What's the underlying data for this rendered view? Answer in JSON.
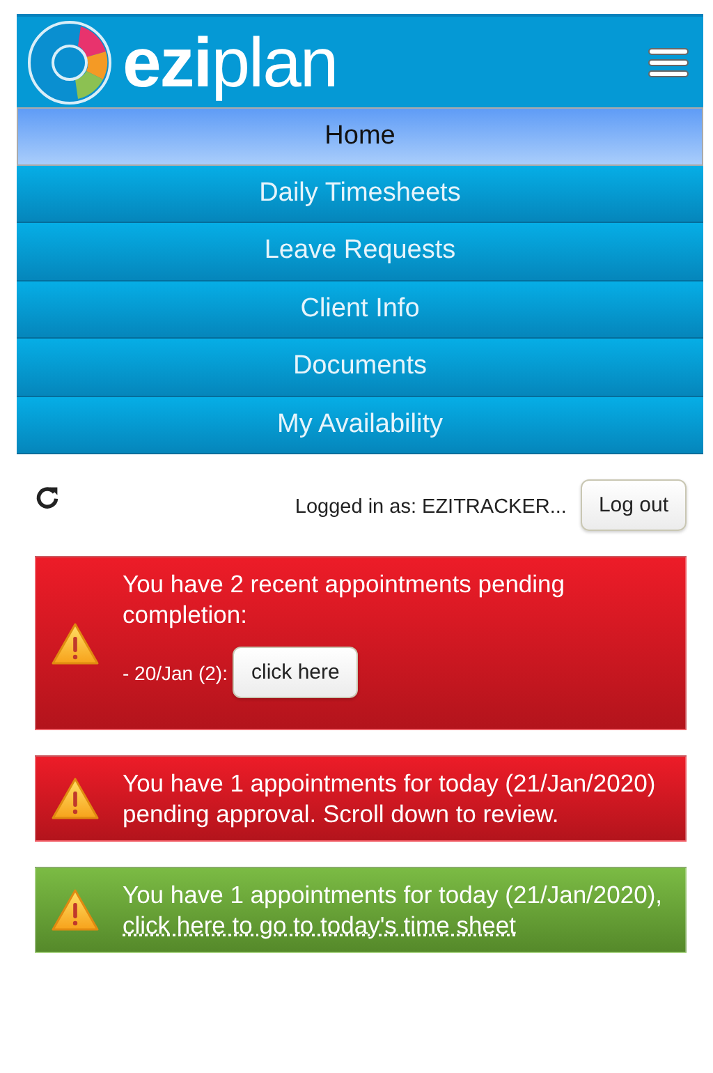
{
  "header": {
    "logo": "**ezi**plan"
  },
  "nav": [
    {
      "label": "Home",
      "selected": true
    },
    {
      "label": "Daily Timesheets",
      "selected": false
    },
    {
      "label": "Leave Requests",
      "selected": false
    },
    {
      "label": "Client Info",
      "selected": false
    },
    {
      "label": "Documents",
      "selected": false
    },
    {
      "label": "My Availability",
      "selected": false
    }
  ],
  "session": {
    "logged_in": "Logged in as: EZITRACKER...",
    "logout": "Log out"
  },
  "alerts": [
    {
      "kind": "danger",
      "message": "You have 2 recent appointments pending completion:",
      "item": {
        "label": "- 20/Jan (2):",
        "button": "click here"
      }
    },
    {
      "kind": "danger",
      "message": "You have 1 appointments for today (21/Jan/2020) pending approval. Scroll down to review."
    },
    {
      "kind": "success",
      "message": "You have 1 appointments for today (21/Jan/2020), ",
      "link": "click here to go to today's time sheet"
    }
  ]
}
